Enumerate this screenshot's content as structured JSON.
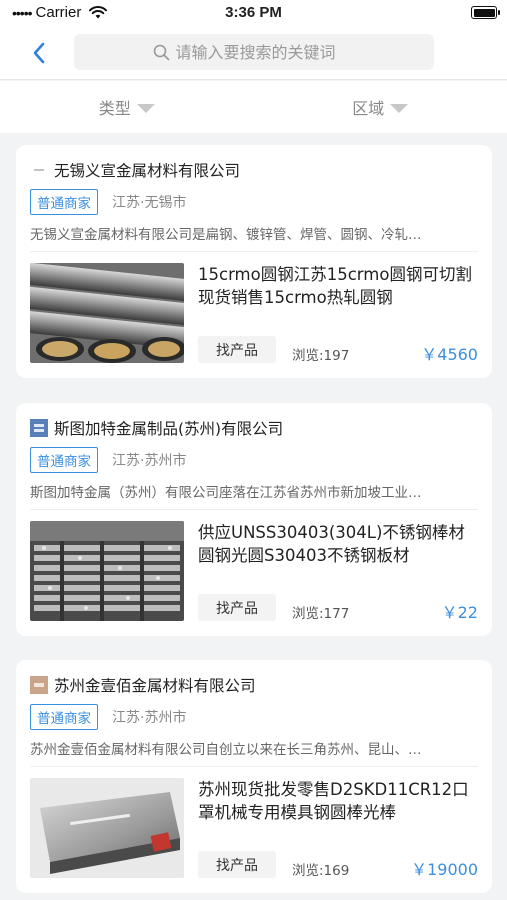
{
  "status_bar": {
    "carrier": "Carrier",
    "time": "3:36 PM"
  },
  "nav": {
    "search_placeholder": "请输入要搜索的关键词",
    "icons": {
      "back": "chevron-left-icon",
      "search": "search-icon"
    }
  },
  "filters": [
    {
      "label": "类型"
    },
    {
      "label": "区域"
    }
  ],
  "companies": [
    {
      "name": "无锡义宣金属材料有限公司",
      "badge": "普通商家",
      "region": "江苏·无锡市",
      "description": "无锡义宣金属材料有限公司是扁钢、镀锌管、焊管、圆钢、冷轧…",
      "product": {
        "title": "15crmo圆钢江苏15crmo圆钢可切割现货销售15crmo热轧圆钢",
        "action": "找产品",
        "views": "浏览:197",
        "price": "￥4560"
      }
    },
    {
      "name": "斯图加特金属制品(苏州)有限公司",
      "badge": "普通商家",
      "region": "江苏·苏州市",
      "description": "斯图加特金属（苏州）有限公司座落在江苏省苏州市新加坡工业…",
      "product": {
        "title": "供应UNSS30403(304L)不锈钢棒材圆钢光圆S30403不锈钢板材",
        "action": "找产品",
        "views": "浏览:177",
        "price": "￥22"
      }
    },
    {
      "name": "苏州金壹佰金属材料有限公司",
      "badge": "普通商家",
      "region": "江苏·苏州市",
      "description": "苏州金壹佰金属材料有限公司自创立以来在长三角苏州、昆山、…",
      "product": {
        "title": "苏州现货批发零售D2SKD11CR12口罩机械专用模具钢圆棒光棒",
        "action": "找产品",
        "views": "浏览:169",
        "price": "￥19000"
      }
    }
  ],
  "colors": {
    "accent": "#3b8fe0",
    "background": "#f2f3f5"
  }
}
